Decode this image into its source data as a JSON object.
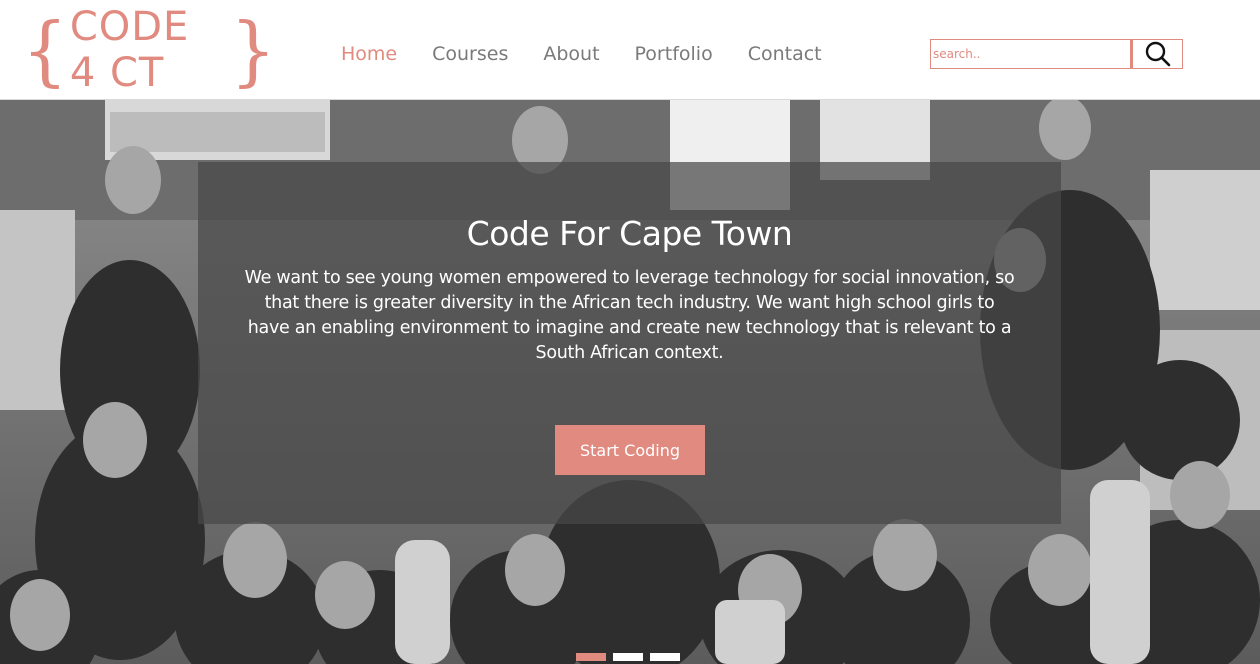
{
  "brand": {
    "logo_text": "CODE 4 CT",
    "brace_open": "{",
    "brace_close": "}",
    "accent_color": "#e08a80"
  },
  "nav": {
    "items": [
      {
        "label": "Home",
        "active": true
      },
      {
        "label": "Courses",
        "active": false
      },
      {
        "label": "About",
        "active": false
      },
      {
        "label": "Portfolio",
        "active": false
      },
      {
        "label": "Contact",
        "active": false
      }
    ]
  },
  "search": {
    "placeholder": "search..",
    "value": "",
    "icon": "search-icon"
  },
  "hero": {
    "title": "Code For Cape Town",
    "text": "We want to see young women empowered to leverage technology for social innovation, so that there is greater diversity in the African tech industry. We want high school girls to have an enabling environment to imagine and create new technology that is relevant to a South African context.",
    "cta_label": "Start Coding",
    "image": "grayscale-group-photo",
    "slides": {
      "count": 3,
      "active": 1
    }
  }
}
